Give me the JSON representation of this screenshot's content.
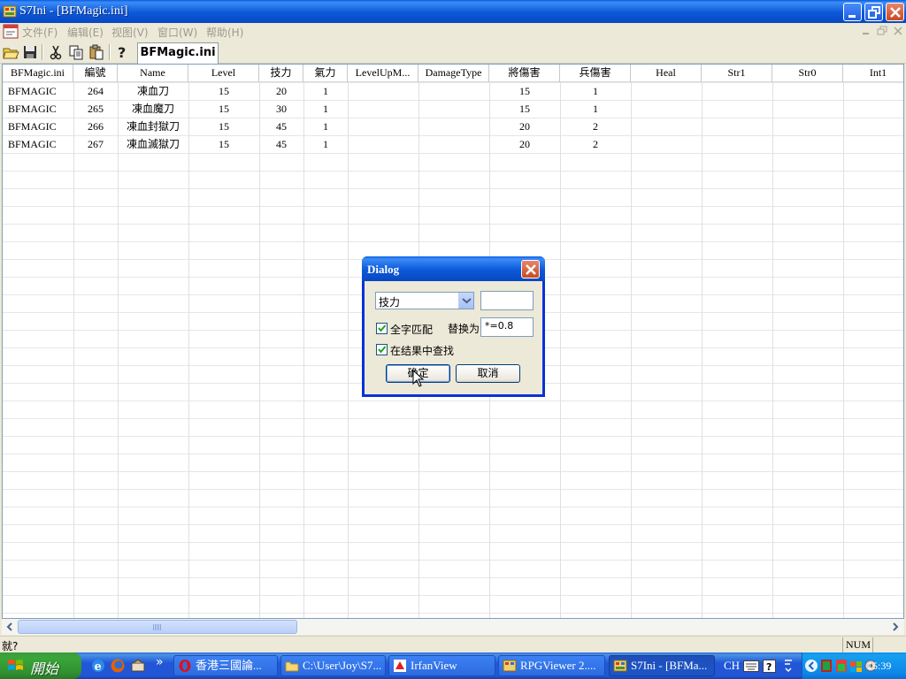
{
  "window": {
    "title": "S7Ini - [BFMagic.ini]"
  },
  "menu": [
    "文件(F)",
    "编辑(E)",
    "视图(V)",
    "窗口(W)",
    "帮助(H)"
  ],
  "toolbar": {
    "doc_tab": "BFMagic.ini"
  },
  "grid": {
    "columns": [
      "BFMagic.ini",
      "編號",
      "Name",
      "Level",
      "技力",
      "氣力",
      "LevelUpM...",
      "DamageType",
      "將傷害",
      "兵傷害",
      "Heal",
      "Str1",
      "Str0",
      "Int1"
    ],
    "rows": [
      [
        "BFMAGIC",
        "264",
        "凍血刀",
        "15",
        "20",
        "1",
        "",
        "",
        "15",
        "1",
        "",
        "",
        "",
        ""
      ],
      [
        "BFMAGIC",
        "265",
        "凍血魔刀",
        "15",
        "30",
        "1",
        "",
        "",
        "15",
        "1",
        "",
        "",
        "",
        ""
      ],
      [
        "BFMAGIC",
        "266",
        "凍血封獄刀",
        "15",
        "45",
        "1",
        "",
        "",
        "20",
        "2",
        "",
        "",
        "",
        ""
      ],
      [
        "BFMAGIC",
        "267",
        "凍血滅獄刀",
        "15",
        "45",
        "1",
        "",
        "",
        "20",
        "2",
        "",
        "",
        "",
        ""
      ]
    ]
  },
  "status": {
    "text": "就?",
    "num": "NUM"
  },
  "dialog": {
    "title": "Dialog",
    "field_select": "技力",
    "search_value": "",
    "whole_match_label": "全字匹配",
    "whole_match_checked": true,
    "replace_label": "替换为",
    "replace_value": "*=0.8",
    "in_results_label": "在结果中查找",
    "in_results_checked": true,
    "ok_label": "确定",
    "cancel_label": "取消"
  },
  "taskbar": {
    "start_label": "開始",
    "tasks": [
      "香港三國論...",
      "C:\\User\\Joy\\S7...",
      "IrfanView",
      "RPGViewer 2....",
      "S7Ini - [BFMa..."
    ],
    "active_task": 4,
    "language": "CH",
    "clock": "15:39"
  }
}
